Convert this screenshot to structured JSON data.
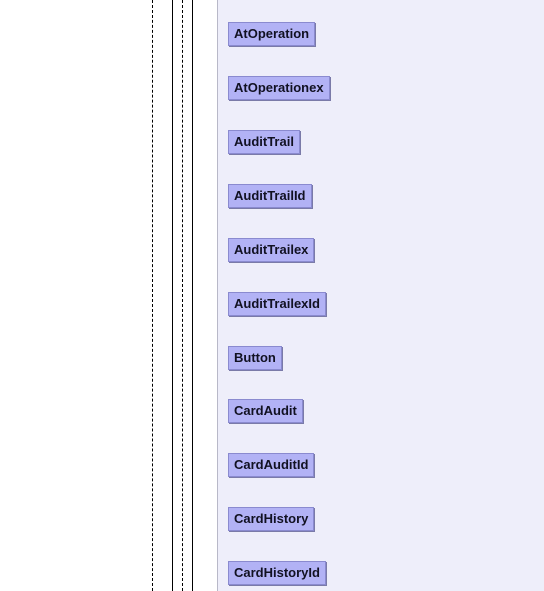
{
  "entities": [
    "AtOperation",
    "AtOperationex",
    "AuditTrail",
    "AuditTrailId",
    "AuditTrailex",
    "AuditTrailexId",
    "Button",
    "CardAudit",
    "CardAuditId",
    "CardHistory",
    "CardHistoryId"
  ]
}
